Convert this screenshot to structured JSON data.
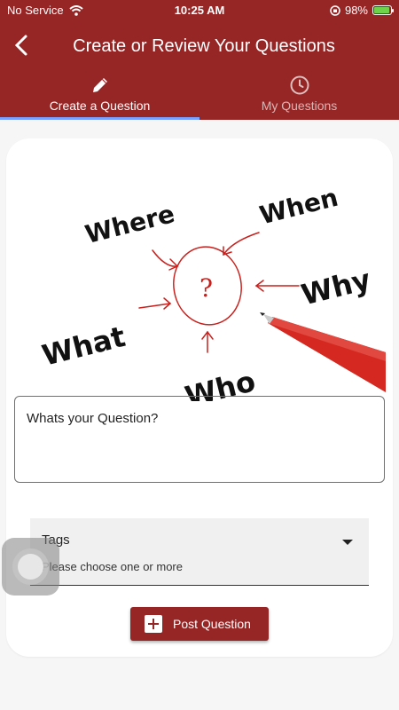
{
  "status": {
    "carrier": "No Service",
    "time": "10:25 AM",
    "battery": "98%"
  },
  "appbar": {
    "title": "Create or Review Your Questions"
  },
  "tabs": [
    {
      "label": "Create a Question",
      "icon": "pencil-icon",
      "active": true
    },
    {
      "label": "My Questions",
      "icon": "clock-icon",
      "active": false
    }
  ],
  "hero": {
    "words": [
      "Where",
      "When",
      "Why",
      "What",
      "Who"
    ],
    "center": "?"
  },
  "form": {
    "question_placeholder": "Whats your Question?",
    "tags_label": "Tags",
    "tags_hint": "Please choose one or more",
    "post_label": "Post Question"
  },
  "colors": {
    "primary": "#962626",
    "indicator": "#7aa0ff",
    "ink_red": "#c8201c"
  }
}
